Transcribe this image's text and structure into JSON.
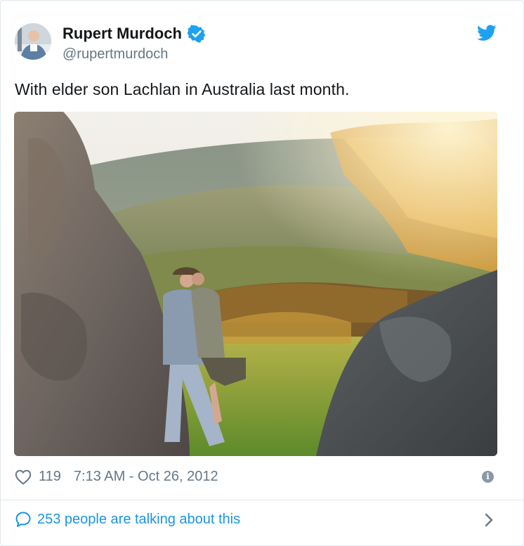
{
  "author": {
    "display_name": "Rupert Murdoch",
    "handle": "@rupertmurdoch",
    "verified": true,
    "avatar_icon": "profile-photo"
  },
  "tweet": {
    "text": "With elder son Lachlan in Australia last month."
  },
  "photo": {
    "icon": "landscape-photo"
  },
  "meta": {
    "likes": "119",
    "timestamp": "7:13 AM - Oct 26, 2012",
    "info_glyph": "i"
  },
  "footer": {
    "talking_text": "253 people are talking about this"
  },
  "colors": {
    "twitter_blue": "#1da1f2",
    "link_blue": "#1b95e0",
    "muted_gray": "#657786",
    "border": "#e1e8ed"
  }
}
